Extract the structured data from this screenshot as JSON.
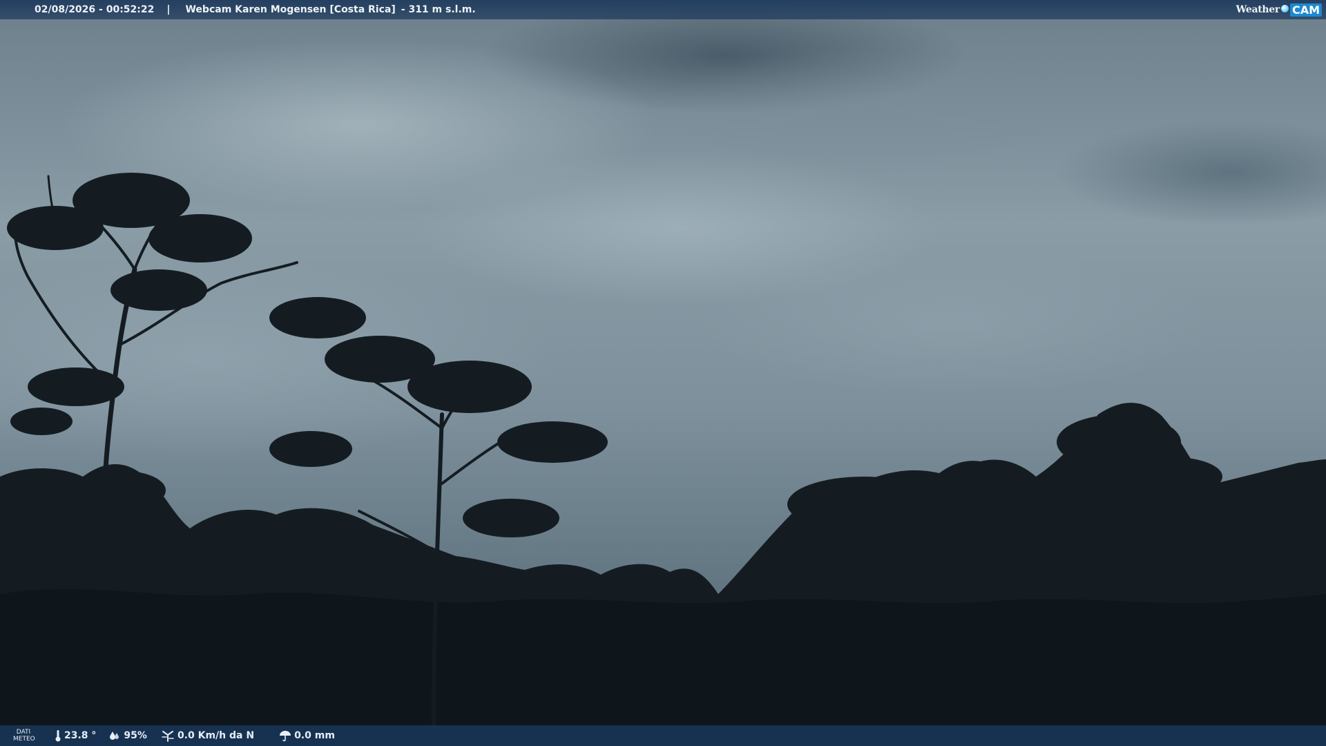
{
  "overlay": {
    "timestamp": "02/08/2026 - 00:52:22",
    "separator": "|",
    "title": "Webcam Karen Mogensen [Costa Rica]",
    "altitude": "- 311 m s.l.m.",
    "brand": {
      "left": "Weather",
      "right": "CAM"
    }
  },
  "weather": {
    "label_line1": "DATI",
    "label_line2": "METEO",
    "temperature": "23.8 °",
    "humidity": "95%",
    "wind": "0.0 Km/h da N",
    "rain": "0.0 mm"
  },
  "icons": {
    "temperature": "thermometer-icon",
    "humidity": "humidity-drops-icon",
    "wind": "wind-icon",
    "rain": "rain-umbrella-icon"
  }
}
